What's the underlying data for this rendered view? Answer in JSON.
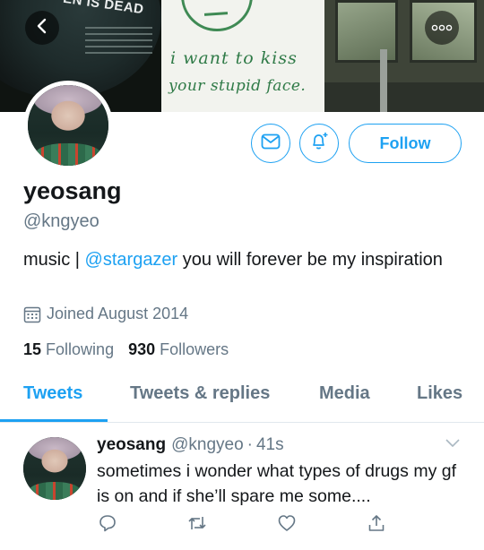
{
  "header": {
    "banner_record_text": "EN IS DEAD",
    "banner_note_line1": "i want to kiss",
    "banner_note_line2": "your stupid face."
  },
  "profile": {
    "name": "yeosang",
    "handle": "@kngyeo",
    "bio_prefix": "music | ",
    "bio_mention": "@stargazer",
    "bio_suffix": " you will forever be my inspiration",
    "joined": "Joined August 2014",
    "following_count": "15",
    "following_label": "Following",
    "followers_count": "930",
    "followers_label": "Followers"
  },
  "actions": {
    "follow_label": "Follow"
  },
  "tabs": [
    {
      "label": "Tweets",
      "active": true
    },
    {
      "label": "Tweets & replies",
      "active": false
    },
    {
      "label": "Media",
      "active": false
    },
    {
      "label": "Likes",
      "active": false
    }
  ],
  "tweet": {
    "name": "yeosang",
    "handle": "@kngyeo",
    "separator": "·",
    "time": "41s",
    "text": "sometimes i wonder what types of drugs my gf is on and if she’ll spare me some...."
  },
  "colors": {
    "accent": "#1da1f2",
    "secondary_text": "#657786",
    "primary_text": "#14171a"
  }
}
